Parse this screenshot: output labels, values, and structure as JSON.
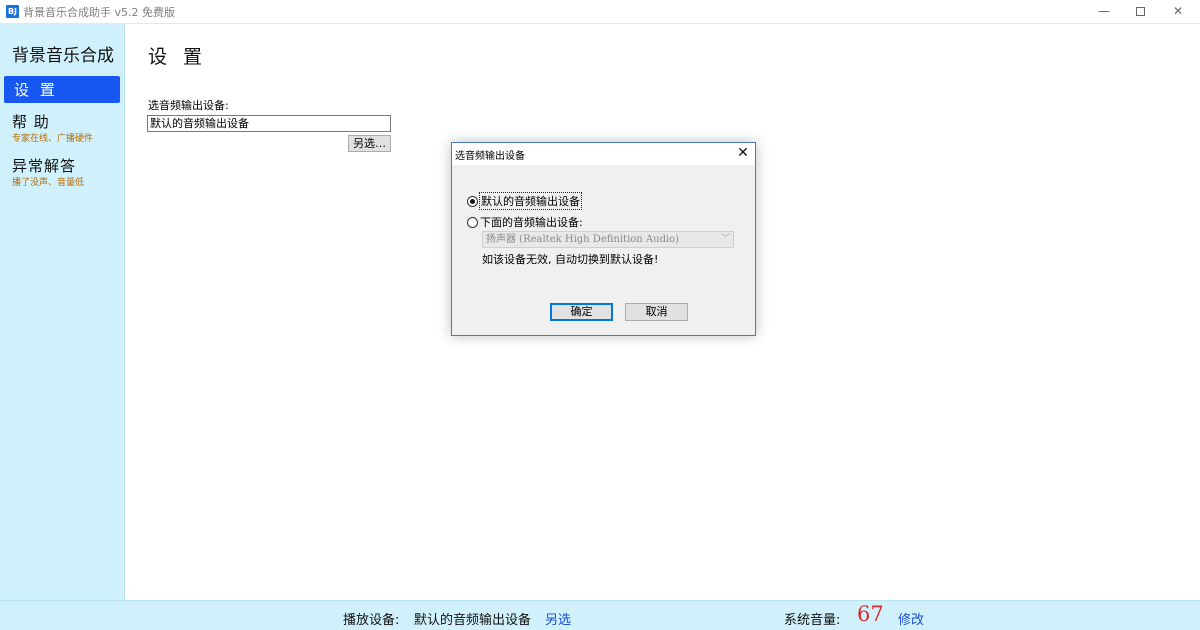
{
  "window": {
    "icon_text": "BJ",
    "title": "背景音乐合成助手 v5.2 免费版",
    "minimize": "—",
    "close": "✕"
  },
  "sidebar": {
    "app_name": "背景音乐合成",
    "items": [
      {
        "label": "设 置",
        "active": true
      },
      {
        "label": "帮 助",
        "sub": "专家在线、广播硬件"
      },
      {
        "label": "异常解答",
        "sub": "播了没声、音量低"
      }
    ]
  },
  "main": {
    "title": "设 置",
    "output_label": "选音频输出设备:",
    "output_value": "默认的音频输出设备",
    "browse_button": "另选…"
  },
  "dialog": {
    "title": "选音频输出设备",
    "close": "✕",
    "option_default": "默认的音频输出设备",
    "option_below": "下面的音频输出设备:",
    "device_selected": "扬声器 (Realtek High Definition Audio)",
    "note": "如该设备无效, 自动切换到默认设备!",
    "ok": "确定",
    "cancel": "取消"
  },
  "status": {
    "play_device_label": "播放设备:",
    "play_device_value": "默认的音频输出设备",
    "play_device_link": "另选",
    "volume_label": "系统音量:",
    "volume_value": "67",
    "volume_link": "修改"
  }
}
